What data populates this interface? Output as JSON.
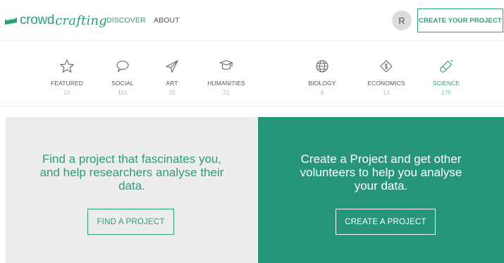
{
  "brand": {
    "part1": "crowd",
    "part2": "crafting",
    "color": "#2a9d7f"
  },
  "nav": {
    "discover": "DISCOVER",
    "about": "ABOUT"
  },
  "user": {
    "avatar_initial": "R"
  },
  "header_cta": "CREATE YOUR PROJECT",
  "categories": [
    {
      "label": "FEATURED",
      "count": "10",
      "icon": "star-icon"
    },
    {
      "label": "SOCIAL",
      "count": "151",
      "icon": "speech-bubble-icon"
    },
    {
      "label": "ART",
      "count": "39",
      "icon": "paper-plane-icon"
    },
    {
      "label": "HUMANITIES",
      "count": "21",
      "icon": "graduation-cap-icon"
    },
    {
      "label": "BIOLOGY",
      "count": "8",
      "icon": "globe-icon"
    },
    {
      "label": "ECONOMICS",
      "count": "13",
      "icon": "money-tag-icon"
    },
    {
      "label": "SCIENCE",
      "count": "175",
      "icon": "test-tube-icon",
      "active": true
    }
  ],
  "find_panel": {
    "line1": "Find a project that fascinates you,",
    "line2": "and help researchers analyse their",
    "line3": "data.",
    "button": "FIND A PROJECT",
    "background": "#ededed"
  },
  "create_panel": {
    "line1": "Create a Project and get other",
    "line2": "volunteers to help you analyse",
    "line3": "your data.",
    "button": "CREATE A PROJECT",
    "background": "#26957a"
  }
}
